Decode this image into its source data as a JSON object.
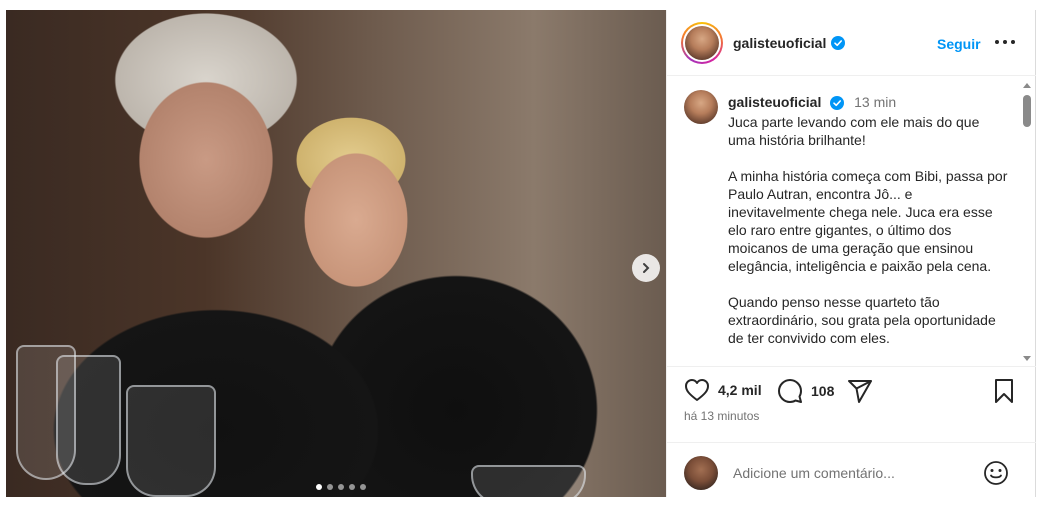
{
  "post": {
    "username": "galisteuoficial",
    "follow_label": "Seguir",
    "carousel": {
      "total": 5,
      "active": 1
    }
  },
  "caption": {
    "username": "galisteuoficial",
    "time": "13 min",
    "paragraphs": [
      "Juca parte levando com ele mais do que uma história brilhante!",
      "A minha história começa com Bibi, passa por Paulo Autran, encontra Jô... e inevitavelmente chega nele. Juca era esse elo raro entre gigantes, o último dos moicanos de uma geração que ensinou elegância, inteligência e paixão pela cena.",
      "Quando penso nesse quarteto tão extraordinário, sou grata pela oportunidade de ter convivido com eles."
    ]
  },
  "actions": {
    "likes": "4,2 mil",
    "comments": "108",
    "time_ago": "há 13 minutos"
  },
  "comment_box": {
    "placeholder": "Adicione um comentário..."
  },
  "icons": [
    "verified-icon",
    "more-options-icon",
    "next-arrow-icon",
    "heart-icon",
    "comment-icon",
    "share-icon",
    "bookmark-icon",
    "emoji-icon"
  ],
  "colors": {
    "link": "#0095f6",
    "muted": "#737373",
    "text": "#262626"
  }
}
